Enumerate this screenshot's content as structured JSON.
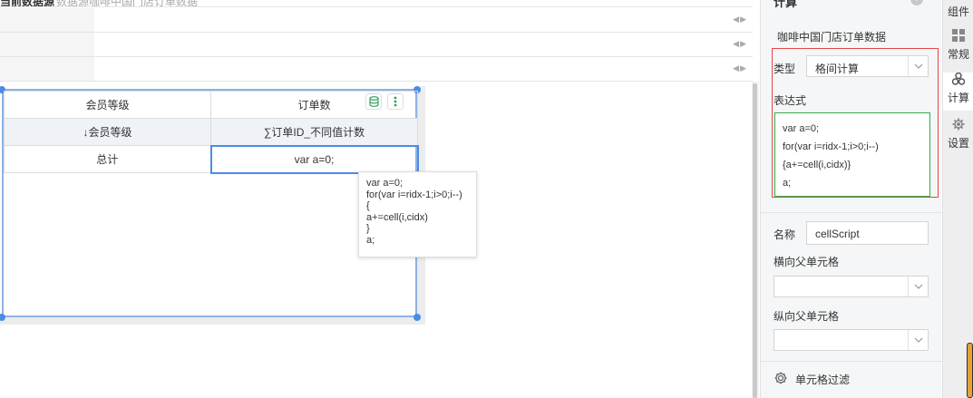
{
  "top": {
    "label": "当前数据源",
    "sublabel": "数据源咖啡中国门店订单数据"
  },
  "table": {
    "header1": [
      "会员等级",
      "订单数"
    ],
    "header2": [
      "↓会员等级",
      "∑订单ID_不同值计数"
    ],
    "row1": [
      "总计",
      "var a=0;"
    ]
  },
  "tooltip": {
    "lines": [
      "var a=0;",
      "for(var i=ridx-1;i>0;i--)",
      "{",
      "a+=cell(i,cidx)",
      "}",
      "a;"
    ]
  },
  "panel": {
    "title": "计算",
    "help": "?",
    "datasource": "咖啡中国门店订单数据",
    "type_label": "类型",
    "type_value": "格间计算",
    "expr_label": "表达式",
    "code_lines": [
      "var a=0;",
      "for(var i=ridx-1;i>0;i--)",
      "{a+=cell(i,cidx)}",
      "a;"
    ],
    "name_label": "名称",
    "name_value": "cellScript",
    "h_parent_label": "横向父单元格",
    "v_parent_label": "纵向父单元格",
    "filter_label": "单元格过滤"
  },
  "tabs": [
    {
      "label": "组件",
      "icon": "component-icon"
    },
    {
      "label": "常规",
      "icon": "grid-icon"
    },
    {
      "label": "计算",
      "icon": "calc-icon",
      "active": true
    },
    {
      "label": "设置",
      "icon": "gear-icon"
    }
  ],
  "colors": {
    "accent": "#4a8be8",
    "highlight_red": "#e64545",
    "code_border": "#32b04a"
  }
}
